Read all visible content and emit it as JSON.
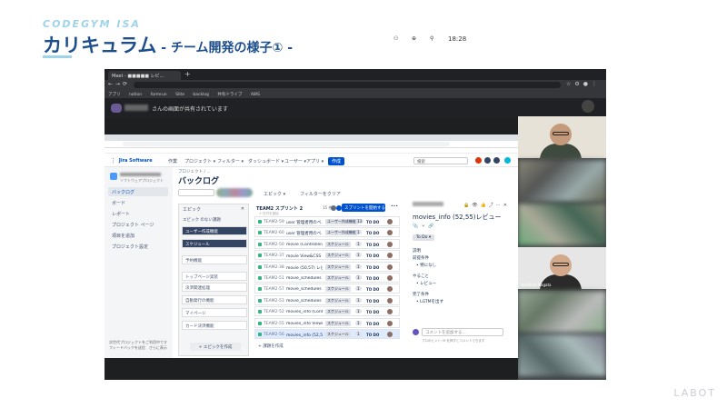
{
  "slide": {
    "brand": "CODEGYM ISA",
    "title_main": "カリキュラム",
    "title_sub": " - チーム開発の様子① -",
    "watermark": "LABOT"
  },
  "browser": {
    "tab_label": "Meet - ■■■■■ レビ...",
    "new_tab": "+",
    "bookmarks": [
      "アプリ",
      "notion",
      "formrun",
      "Slite",
      "backlog",
      "共有ドライブ",
      "AWS"
    ]
  },
  "meet": {
    "sharing_text": "さんの画面が共有されています",
    "time": "18:28",
    "participants": [
      "",
      "",
      "",
      "",
      "Yoshihiro Nagata",
      "",
      ""
    ]
  },
  "jira": {
    "product": "Jira Software",
    "nav": [
      "作業",
      "プロジェクト ▾",
      "フィルター ▾",
      "ダッシュボード ▾",
      "ユーザー ▾",
      "アプリ ▾"
    ],
    "create_btn": "作成",
    "search_placeholder": "検索",
    "project_type": "ソフトウェアプロジェクト",
    "sidebar": [
      "バックログ",
      "ボード",
      "レポート",
      "プロジェクト ページ",
      "項目を追加",
      "プロジェクト設定"
    ],
    "sidebar_footer": [
      "次世代プロジェクトをご利用中です",
      "フィードバックを送信　さらに表示"
    ],
    "breadcrumb": "プロジェクト / ...",
    "page_title": "バックログ",
    "epic_filter": "エピック ▾",
    "clear_filter": "フィルターをクリア",
    "epic_panel": {
      "header": "エピック",
      "close": "✕",
      "no_epic": "エピック のない課題",
      "items": [
        "ユーザー作成機能",
        "スケジュール",
        "予約機能",
        "トップページ実装",
        "決済関連処理",
        "自動発行の機能",
        "マイページ",
        "カード決済機能"
      ],
      "create": "+ エピックを作成"
    },
    "sprint": {
      "name": "TEAM2 スプリント 2",
      "count": "15 件",
      "start_btn": "スプリントを開始する",
      "more": "•••",
      "subtitle": "+ 日付を追加",
      "create_issue": "+ 課題を作成",
      "issues": [
        {
          "key": "TEAM2-59",
          "summary": "user 管理者用のペ...",
          "label": "ユーザー作成機能",
          "points": "13",
          "status": "TO DO"
        },
        {
          "key": "TEAM2-60",
          "summary": "user 管理者用のペ...",
          "label": "ユーザー作成機能",
          "points": "1",
          "status": "TO DO"
        },
        {
          "key": "TEAM2-50",
          "summary": "movie (Controller/Mod...",
          "label": "スケジュール",
          "points": "1",
          "status": "TO DO"
        },
        {
          "key": "TEAM2-37",
          "summary": "movie View&CSS 実装",
          "label": "スケジュール",
          "points": "1",
          "status": "TO DO"
        },
        {
          "key": "TEAM2-38",
          "summary": "movie (50,57) レビュー",
          "label": "スケジュール",
          "points": "1",
          "status": "TO DO"
        },
        {
          "key": "TEAM2-51",
          "summary": "movie_schedules (Contr...",
          "label": "スケジュール",
          "points": "1",
          "status": "TO DO"
        },
        {
          "key": "TEAM2-57",
          "summary": "movie_schedules View...",
          "label": "スケジュール",
          "points": "1",
          "status": "TO DO"
        },
        {
          "key": "TEAM2-53",
          "summary": "movie_schedules (51,...",
          "label": "スケジュール",
          "points": "1",
          "status": "TO DO"
        },
        {
          "key": "TEAM2-52",
          "summary": "movies_info (Controller...",
          "label": "スケジュール",
          "points": "1",
          "status": "TO DO"
        },
        {
          "key": "TEAM2-55",
          "summary": "movies_info View&CS...",
          "label": "スケジュール",
          "points": "1",
          "status": "TO DO"
        },
        {
          "key": "TEAM2-56",
          "summary": "movies_info (52,55) レ...",
          "label": "スケジュール",
          "points": "1",
          "status": "TO DO"
        }
      ]
    },
    "detail": {
      "title": "movies_info (52,55)レビュー",
      "status": "To Do ▾",
      "desc_label": "説明",
      "field1": "前提条件",
      "field1_val": "• 特になし",
      "field2": "やること",
      "field2_val": "• レビュー",
      "field3": "完了条件",
      "field3_val": "• LGTMを出す",
      "comment_placeholder": "コメントを追加する...",
      "tip": "プロのヒント: M を押すとコメントできます"
    }
  }
}
